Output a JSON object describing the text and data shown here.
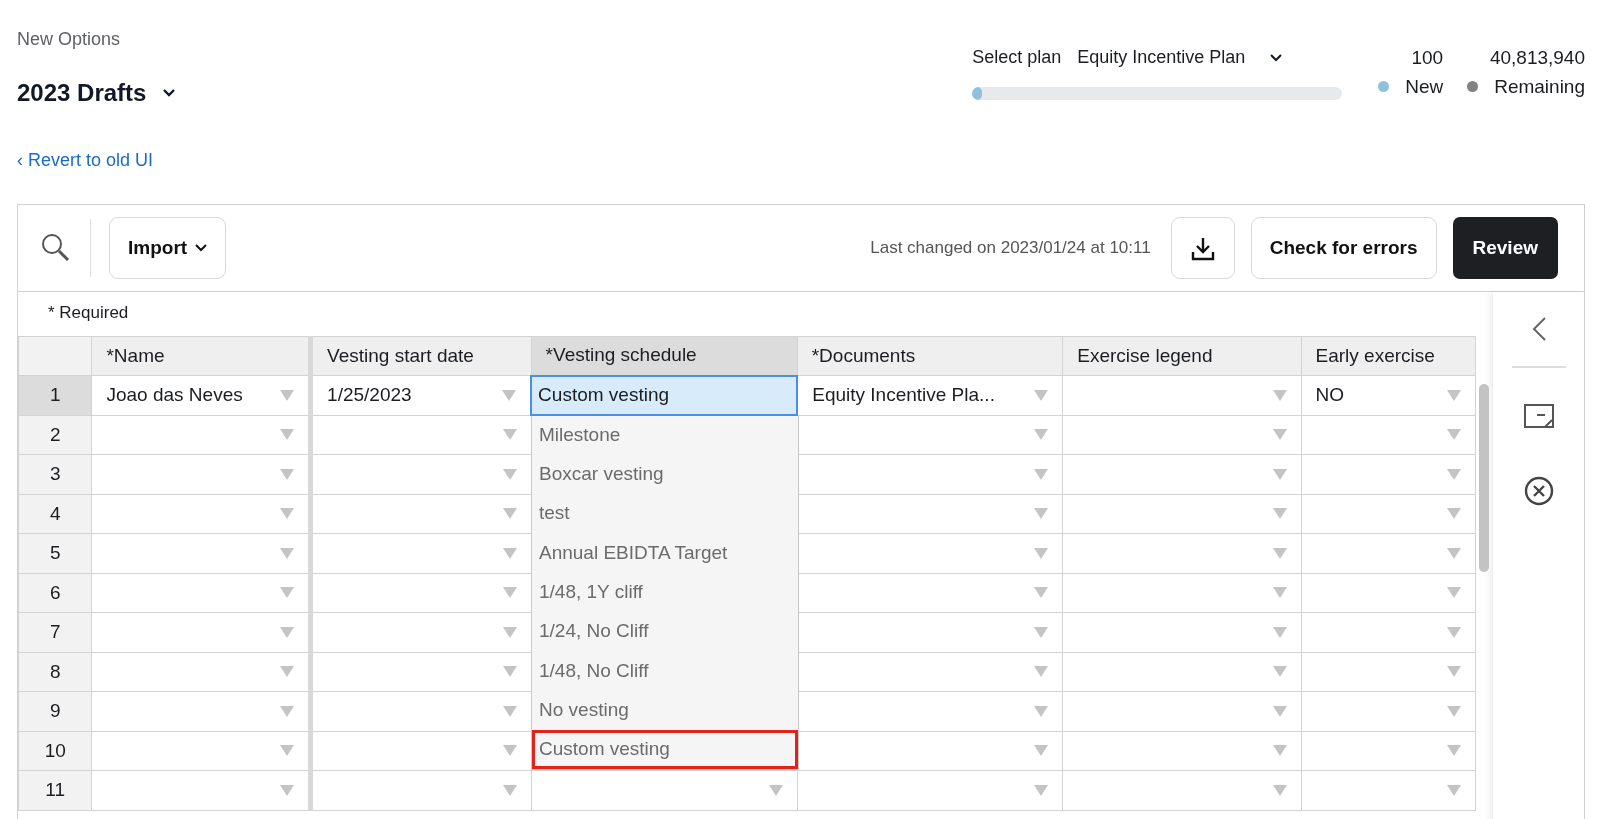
{
  "header": {
    "subtitle": "New Options",
    "title": "2023 Drafts",
    "back_link": "‹ Revert to old UI"
  },
  "plan": {
    "label": "Select plan",
    "value": "Equity Incentive Plan",
    "level": 0.01,
    "legend": [
      {
        "count": "100",
        "label": "New",
        "color": "#8fc1dd"
      },
      {
        "count": "40,813,940",
        "label": "Remaining",
        "color": "#808284"
      }
    ]
  },
  "toolbar": {
    "import": "Import",
    "last_changed": "Last changed on 2023/01/24 at 10:11",
    "check": "Check for errors",
    "review": "Review"
  },
  "required_note": "* Required",
  "table": {
    "columns": [
      {
        "label": "*Name",
        "selected": false
      },
      {
        "label": "Vesting start date",
        "selected": false
      },
      {
        "label": "*Vesting schedule",
        "selected": true
      },
      {
        "label": "*Documents",
        "selected": false
      },
      {
        "label": "Exercise legend",
        "selected": false
      },
      {
        "label": "Early exercise",
        "selected": false
      }
    ],
    "rows": [
      {
        "number": "1",
        "selected": true,
        "cells": [
          {
            "text": "Joao das Neves",
            "active": false
          },
          {
            "text": "1/25/2023",
            "active": false
          },
          {
            "text": "Custom vesting",
            "active": true
          },
          {
            "text": "Equity Incentive Pla...",
            "active": false
          },
          {
            "active": false
          },
          {
            "text": "NO",
            "active": false
          }
        ]
      },
      {
        "number": "2",
        "selected": false
      },
      {
        "number": "3",
        "selected": false
      },
      {
        "number": "4",
        "selected": false
      },
      {
        "number": "5",
        "selected": false
      },
      {
        "number": "6",
        "selected": false
      },
      {
        "number": "7",
        "selected": false
      },
      {
        "number": "8",
        "selected": false
      },
      {
        "number": "9",
        "selected": false
      },
      {
        "number": "10",
        "selected": false
      },
      {
        "number": "11",
        "selected": false
      }
    ]
  },
  "dropdown": {
    "options": [
      {
        "label": "Milestone",
        "highlighted": false
      },
      {
        "label": "Boxcar vesting",
        "highlighted": false
      },
      {
        "label": "test",
        "highlighted": false
      },
      {
        "label": "Annual EBIDTA Target",
        "highlighted": false
      },
      {
        "label": "1/48, 1Y cliff",
        "highlighted": false
      },
      {
        "label": "1/24, No Cliff",
        "highlighted": false
      },
      {
        "label": "1/48, No Cliff",
        "highlighted": false
      },
      {
        "label": "No vesting",
        "highlighted": false
      },
      {
        "label": "Custom vesting",
        "highlighted": true
      }
    ]
  }
}
